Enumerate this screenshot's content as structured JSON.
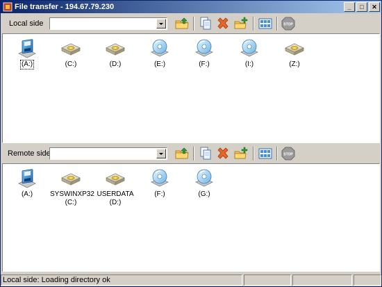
{
  "window": {
    "title": "File transfer - 194.67.79.230",
    "minimize": "_",
    "maximize": "□",
    "close": "✕"
  },
  "local": {
    "label": "Local side",
    "path_value": "",
    "drives": [
      {
        "label": "(A:)",
        "icon": "floppy-drive-icon"
      },
      {
        "label": "(C:)",
        "icon": "hard-drive-icon"
      },
      {
        "label": "(D:)",
        "icon": "hard-drive-icon"
      },
      {
        "label": "(E:)",
        "icon": "cd-drive-icon"
      },
      {
        "label": "(F:)",
        "icon": "cd-drive-icon"
      },
      {
        "label": "(I:)",
        "icon": "cd-drive-icon"
      },
      {
        "label": "(Z:)",
        "icon": "hard-drive-icon"
      }
    ]
  },
  "remote": {
    "label": "Remote side",
    "path_value": "",
    "drives": [
      {
        "label": "(A:)",
        "icon": "floppy-drive-icon"
      },
      {
        "label": "SYSWINXP32\n(C:)",
        "icon": "hard-drive-icon"
      },
      {
        "label": "USERDATA\n(D:)",
        "icon": "hard-drive-icon"
      },
      {
        "label": "(F:)",
        "icon": "cd-drive-icon"
      },
      {
        "label": "(G:)",
        "icon": "cd-drive-icon"
      }
    ]
  },
  "toolbar_icons": [
    "folder-up-icon",
    "copy-icon",
    "delete-icon",
    "new-folder-icon",
    "view-icon",
    "stop-icon"
  ],
  "stop_text": "STOP",
  "status": {
    "text": "Local side: Loading directory  ok"
  }
}
